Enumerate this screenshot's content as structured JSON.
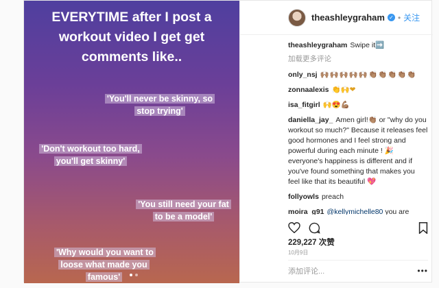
{
  "story": {
    "headline": "EVERYTIME after I post a workout video I get get comments like..",
    "quotes": [
      "'You'll never be skinny, so stop trying'",
      "'Don't workout too hard, you'll get skinny'",
      "'You still need your fat to be a model'",
      "'Why would you want to loose what made you famous'"
    ]
  },
  "header": {
    "username": "theashleygraham",
    "follow_label": "关注"
  },
  "caption": {
    "user": "theashleygraham",
    "text": "Swipe it➡️"
  },
  "load_more": "加载更多评论",
  "comments": [
    {
      "user": "only_nsj",
      "text": "🙌🏽🙌🏽🙌🏽🙌🏽🙌🏽👏🏽👏🏽👏🏽👏🏽👏🏽"
    },
    {
      "user": "zonnaalexis",
      "text": "👏🙌❤"
    },
    {
      "user": "isa_fitgirl",
      "text": "🙌😍💪🏽"
    },
    {
      "user": "daniella_jay_",
      "text": "Amen girl!👏🏽 or \"why do you workout so much?\" Because it releases feel good hormones and I feel strong and powerful during each minute ! 🎉 everyone's happiness is different and if you've found something that makes you feel like that its beautiful 💖"
    },
    {
      "user": "follyowls",
      "text": "preach"
    },
    {
      "user": "moira_g91",
      "mention": "@kellymichelle80",
      "text": "you are absolutly right, and the most sad of it is that they try to make people feel bad bc they feel bad, and can't stand other people's selflove!!! It is really sad to se!!!"
    }
  ],
  "likes": "229,227 次赞",
  "date": "10月9日",
  "add_comment_placeholder": "添加评论...",
  "colors": {
    "link": "#3897f0",
    "text": "#262626",
    "muted": "#999999"
  }
}
